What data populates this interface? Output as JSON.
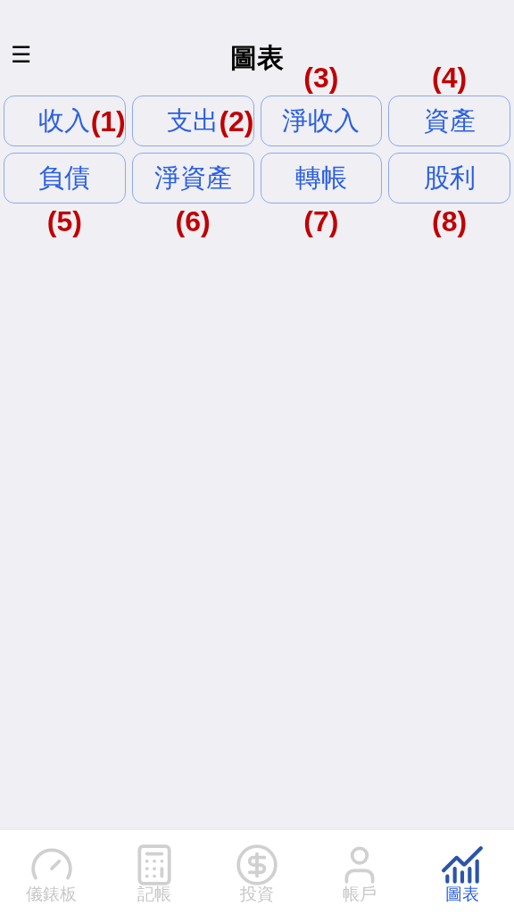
{
  "header": {
    "menu_icon": "☰",
    "title": "圖表"
  },
  "chart_buttons": [
    {
      "label": "收入",
      "note": "(1)"
    },
    {
      "label": "支出",
      "note": "(2)"
    },
    {
      "label": "淨收入",
      "note": "(3)"
    },
    {
      "label": "資產",
      "note": "(4)"
    },
    {
      "label": "負債",
      "note": "(5)"
    },
    {
      "label": "淨資產",
      "note": "(6)"
    },
    {
      "label": "轉帳",
      "note": "(7)"
    },
    {
      "label": "股利",
      "note": "(8)"
    }
  ],
  "tab_bar": [
    {
      "label": "儀錶板",
      "selected": false
    },
    {
      "label": "記帳",
      "selected": false
    },
    {
      "label": "投資",
      "selected": false
    },
    {
      "label": "帳戶",
      "selected": false
    },
    {
      "label": "圖表",
      "selected": true
    }
  ]
}
